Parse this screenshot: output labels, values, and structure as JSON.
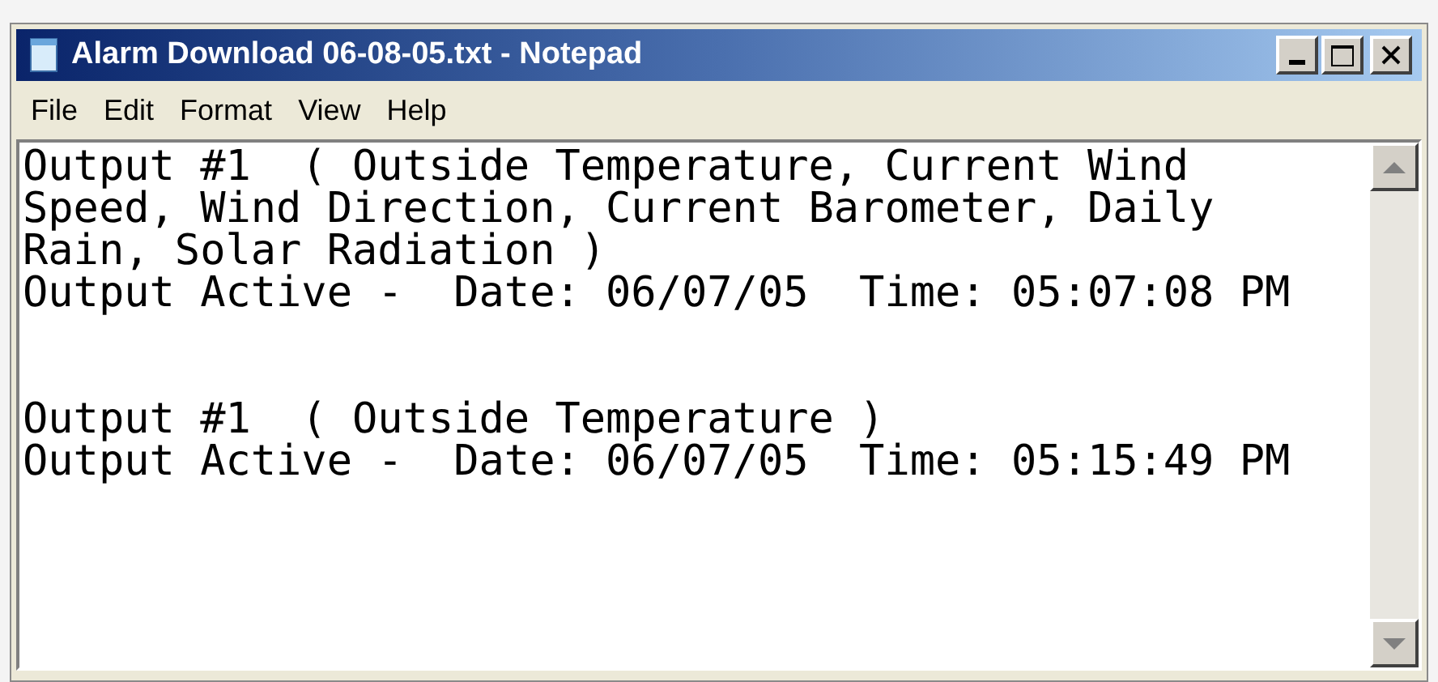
{
  "window": {
    "title": "Alarm Download 06-08-05.txt - Notepad"
  },
  "menu": [
    "File",
    "Edit",
    "Format",
    "View",
    "Help"
  ],
  "document": {
    "blocks": [
      [
        "Output #1  ( Outside Temperature, Current Wind",
        "Speed, Wind Direction, Current Barometer, Daily",
        "Rain, Solar Radiation )",
        "Output Active -  Date: 06/07/05  Time: 05:07:08 PM"
      ],
      [
        "Output #1  ( Outside Temperature )",
        "Output Active -  Date: 06/07/05  Time: 05:15:49 PM"
      ]
    ]
  }
}
